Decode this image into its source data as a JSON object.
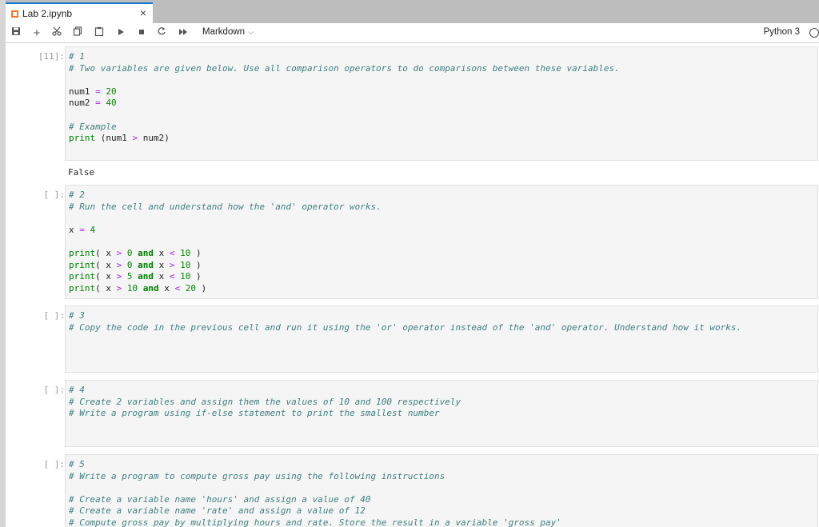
{
  "tab": {
    "title": "Lab 2.ipynb",
    "close": "×"
  },
  "toolbar": {
    "cell_type": "Markdown",
    "kernel_name": "Python 3"
  },
  "cells": [
    {
      "prompt": "[11]:",
      "output": "False"
    },
    {
      "prompt": "[ ]:"
    },
    {
      "prompt": "[ ]:"
    },
    {
      "prompt": "[ ]:"
    },
    {
      "prompt": "[ ]:"
    }
  ]
}
